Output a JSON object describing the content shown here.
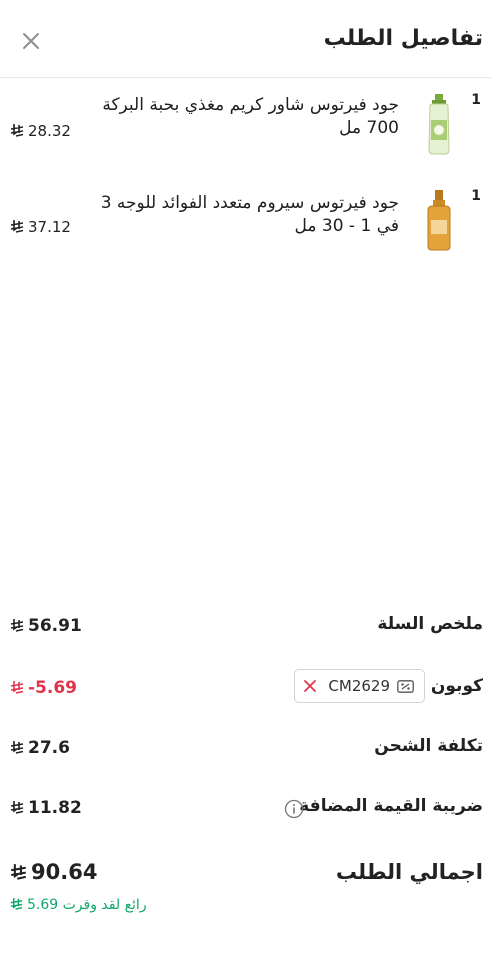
{
  "header": {
    "title": "تفاصيل الطلب",
    "close_icon": "close-icon"
  },
  "items": [
    {
      "qty": "1",
      "name": "جود فيرتوس شاور كريم مغذي بحبة البركة 700 مل",
      "price": "28.32",
      "thumb_color": "#a8c96a"
    },
    {
      "qty": "1",
      "name": "جود فيرتوس سيروم متعدد الفوائد للوجه 3 في 1 - 30 مل",
      "price": "37.12",
      "thumb_color": "#d9901c"
    }
  ],
  "summary": {
    "basket_label": "ملخص السلة",
    "basket_value": "56.91",
    "coupon_label": "كوبون",
    "coupon_code": "CM2629",
    "coupon_value": "-5.69",
    "shipping_label": "تكلفة الشحن",
    "shipping_value": "27.6",
    "vat_label": "ضريبة القيمة المضافة",
    "vat_value": "11.82"
  },
  "total": {
    "label": "اجمالي الطلب",
    "value": "90.64",
    "savings_text": "رائع لقد وفرت",
    "savings_value": "5.69"
  },
  "colors": {
    "discount": "#e0344b",
    "savings": "#0fa86a",
    "divider": "#e6e8ec"
  }
}
